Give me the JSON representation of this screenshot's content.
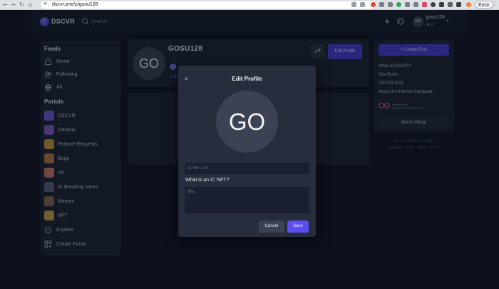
{
  "browser": {
    "url": "dscvr.one/u/gosu128",
    "error_chip": "Error"
  },
  "header": {
    "logo_text": "DSCVR",
    "search_placeholder": "Search",
    "user": {
      "avatar_initials": "GO",
      "username": "gosu128",
      "points": "0"
    }
  },
  "sidebar": {
    "feeds_title": "Feeds",
    "feeds": [
      {
        "label": "Home",
        "icon": "home-icon"
      },
      {
        "label": "Following",
        "icon": "users-icon"
      },
      {
        "label": "All",
        "icon": "globe-icon"
      }
    ],
    "portals_title": "Portals",
    "portals": [
      {
        "label": "DSCVR",
        "color": "#6b5fd8"
      },
      {
        "label": "General",
        "color": "#7f5bc4"
      },
      {
        "label": "Feature Requests",
        "color": "#c99a3a"
      },
      {
        "label": "Bugs",
        "color": "#b87a4a"
      },
      {
        "label": "Art",
        "color": "#c77b6a"
      },
      {
        "label": "IC Breaking News",
        "color": "#5a6478"
      },
      {
        "label": "Memes",
        "color": "#8a6a55"
      },
      {
        "label": "NFT",
        "color": "#c9a04a"
      }
    ],
    "explore_label": "Explore",
    "create_portal_label": "Create Portal"
  },
  "profile": {
    "avatar_initials": "GO",
    "name": "GOSU128",
    "follow_text": "0 Fo",
    "edit_button": "Edit Profile"
  },
  "right": {
    "create_post": "+  Create Post",
    "links": [
      "What is DSCVR?",
      "Site Rules",
      "DSCVR FAQ",
      "About the Internet Computer"
    ],
    "ic_badge": [
      "Powered by",
      "INTERNET COMPUTER"
    ],
    "hiring": "We're Hiring!",
    "footer_line1": "Share DSCVR on Twitter",
    "footer_line2": "Features · Bugs · Ideas · Terms"
  },
  "modal": {
    "close_symbol": "×",
    "title": "Edit Profile",
    "avatar_initials": "GO",
    "nft_placeholder": "IC NFT Url",
    "nft_help_link": "What is an IC NFT?",
    "bio_placeholder": "Bio...",
    "cancel_label": "Cancel",
    "save_label": "Save"
  },
  "colors": {
    "accent": "#4a3fd6",
    "background": "#0f1525",
    "card": "#1c2333",
    "modal": "#262d3d"
  }
}
